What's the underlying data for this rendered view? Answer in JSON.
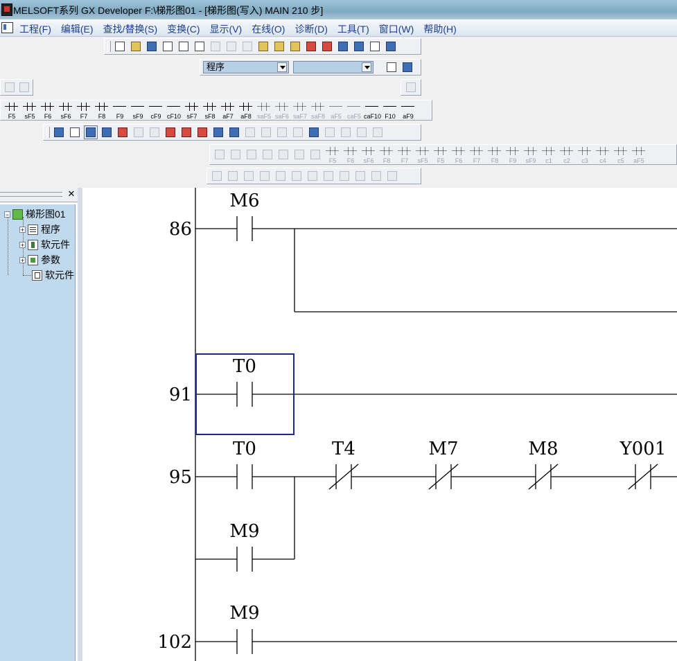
{
  "window": {
    "title": "MELSOFT系列 GX Developer F:\\梯形图01 - [梯形图(写入)      MAIN     210 步]"
  },
  "menu": [
    "工程(F)",
    "编辑(E)",
    "查找/替换(S)",
    "变换(C)",
    "显示(V)",
    "在线(O)",
    "诊断(D)",
    "工具(T)",
    "窗口(W)",
    "帮助(H)"
  ],
  "toolbar": {
    "program_select": "程序",
    "second_select": ""
  },
  "function_keys": [
    "F5",
    "sF5",
    "F6",
    "sF6",
    "F7",
    "F8",
    "F9",
    "sF9",
    "cF9",
    "cF10",
    "sF7",
    "sF8",
    "aF7",
    "aF8",
    "saF5",
    "saF6",
    "saF7",
    "saF8",
    "aF5",
    "caF5",
    "caF10",
    "F10",
    "aF9"
  ],
  "ladder_keys": [
    "F5",
    "F6",
    "sF6",
    "F8",
    "F7",
    "sF5",
    "F5",
    "F6",
    "F7",
    "F8",
    "F9",
    "sF9",
    "c1",
    "c2",
    "c3",
    "c4",
    "c5",
    "aF5"
  ],
  "tree": {
    "root": "梯形图01",
    "items": [
      "程序",
      "软元件",
      "参数",
      "软元件"
    ]
  },
  "ladder": {
    "rungs": [
      {
        "step": "86",
        "contacts": [
          {
            "label": "M6",
            "type": "NO"
          }
        ]
      },
      {
        "step": "91",
        "contacts": [
          {
            "label": "T0",
            "type": "NO"
          }
        ]
      },
      {
        "step": "95",
        "contacts": [
          {
            "label": "T0",
            "type": "NO"
          },
          {
            "label": "T4",
            "type": "NC"
          },
          {
            "label": "M7",
            "type": "NC"
          },
          {
            "label": "M8",
            "type": "NC"
          },
          {
            "label": "Y001",
            "type": "NC"
          }
        ],
        "parallel": [
          {
            "label": "M9",
            "type": "NO"
          }
        ]
      },
      {
        "step": "102",
        "contacts": [
          {
            "label": "M9",
            "type": "NO"
          }
        ]
      }
    ]
  },
  "colors": {
    "cursor": "#1a2a8a",
    "tree_bg": "#c0d9ec"
  }
}
